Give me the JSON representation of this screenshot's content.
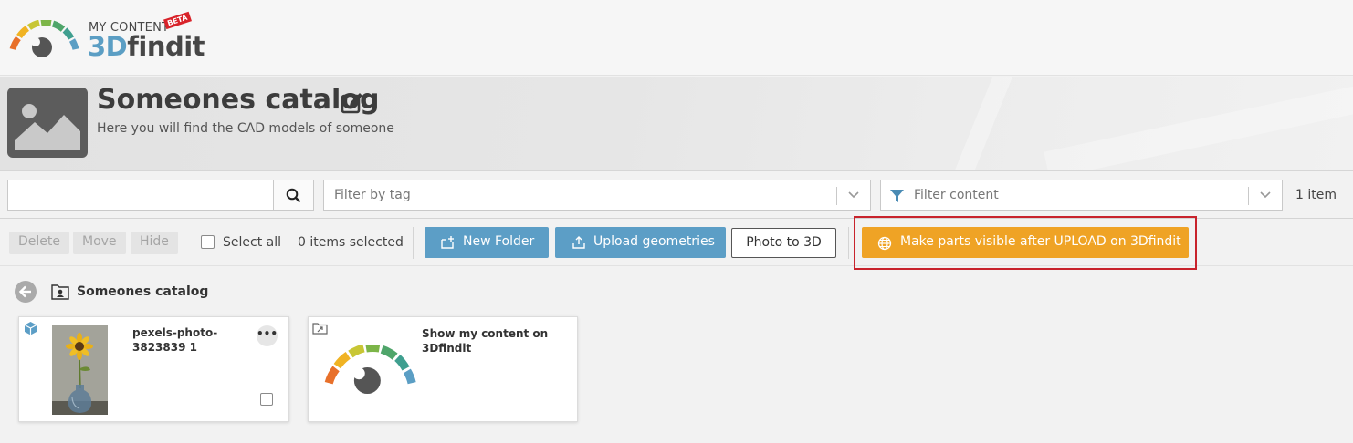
{
  "app": {
    "logo_top": "MY CONTENT",
    "logo_badge": "BETA",
    "logo_brand_3d": "3D",
    "logo_brand_rest": "findit"
  },
  "catalog": {
    "title": "Someones catalog",
    "subtitle": "Here you will find the CAD models of someone"
  },
  "filters": {
    "search_value": "",
    "tag_placeholder": "Filter by tag",
    "content_placeholder": "Filter content",
    "item_count": "1 item"
  },
  "actions": {
    "delete": "Delete",
    "move": "Move",
    "hide": "Hide",
    "select_all": "Select all",
    "items_selected": "0 items selected",
    "new_folder": "New Folder",
    "upload_geometries": "Upload geometries",
    "photo_to_3d": "Photo to 3D",
    "make_visible": "Make parts visible after UPLOAD on 3Dfindit"
  },
  "breadcrumb": {
    "current": "Someones catalog"
  },
  "cards": [
    {
      "title_line1": "pexels-photo-",
      "title_line2": "3823839 1",
      "more": "•••"
    },
    {
      "title_line1": "Show my content on",
      "title_line2": "3Dfindit"
    }
  ],
  "colors": {
    "accent_blue": "#5c9ec6",
    "accent_orange": "#efa325",
    "highlight_red": "#c8232c"
  },
  "icons": [
    "search-icon",
    "chevron-down-icon",
    "filter-icon",
    "folder-plus-icon",
    "upload-icon",
    "globe-icon",
    "back-arrow-icon",
    "user-folder-icon",
    "cube-icon",
    "link-icon",
    "edit-icon",
    "image-placeholder-icon"
  ]
}
